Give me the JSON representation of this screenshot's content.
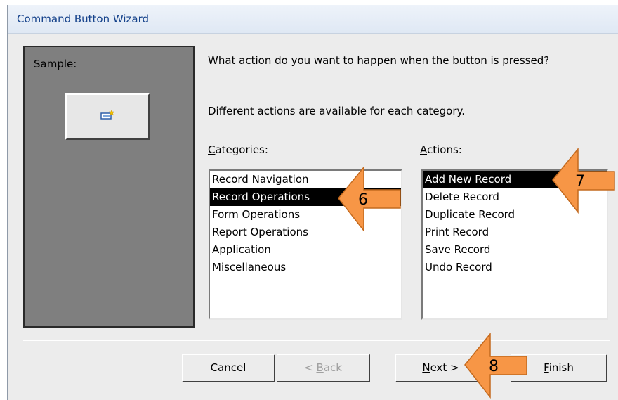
{
  "window": {
    "title": "Command Button Wizard"
  },
  "sample": {
    "label": "Sample:"
  },
  "question": "What action do you want to happen when the button is pressed?",
  "info": "Different actions are available for each category.",
  "categories": {
    "label_accel": "C",
    "label_rest": "ategories:",
    "items": [
      {
        "label": "Record Navigation",
        "selected": false
      },
      {
        "label": "Record Operations",
        "selected": true
      },
      {
        "label": "Form Operations",
        "selected": false
      },
      {
        "label": "Report Operations",
        "selected": false
      },
      {
        "label": "Application",
        "selected": false
      },
      {
        "label": "Miscellaneous",
        "selected": false
      }
    ]
  },
  "actions": {
    "label_accel": "A",
    "label_rest": "ctions:",
    "items": [
      {
        "label": "Add New Record",
        "selected": true
      },
      {
        "label": "Delete Record",
        "selected": false
      },
      {
        "label": "Duplicate Record",
        "selected": false
      },
      {
        "label": "Print Record",
        "selected": false
      },
      {
        "label": "Save Record",
        "selected": false
      },
      {
        "label": "Undo Record",
        "selected": false
      }
    ]
  },
  "buttons": {
    "cancel": "Cancel",
    "back_prefix": "< ",
    "back_accel": "B",
    "back_rest": "ack",
    "next_accel": "N",
    "next_rest": "ext >",
    "finish_accel": "F",
    "finish_rest": "inish"
  },
  "callouts": {
    "step6": "6",
    "step7": "7",
    "step8": "8"
  },
  "colors": {
    "callout_fill": "#f79646",
    "callout_stroke": "#c46a1e",
    "title_text": "#15428b",
    "selection": "#000000"
  },
  "icons": {
    "sample_button": "new-record-icon"
  }
}
